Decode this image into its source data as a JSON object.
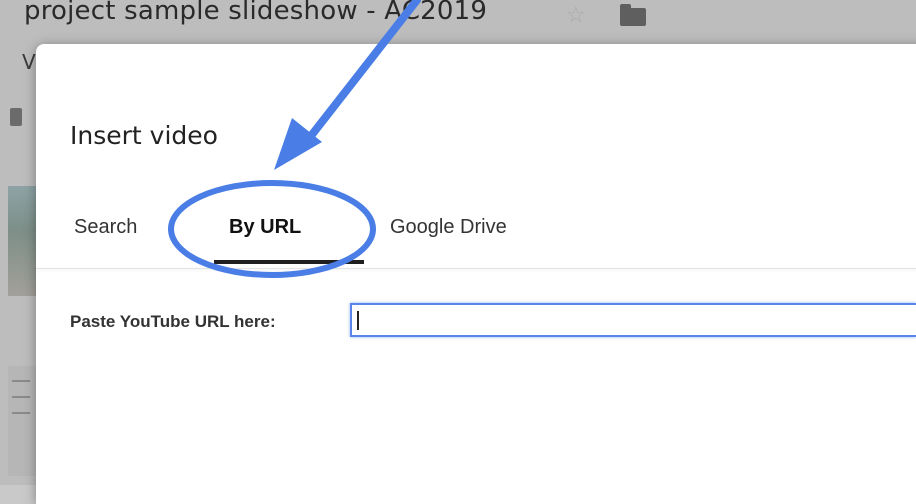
{
  "background": {
    "document_title": "project sample slideshow - AC2019",
    "menu_letter": "V",
    "icons": [
      "star-icon",
      "folder-icon"
    ]
  },
  "dialog": {
    "title": "Insert video",
    "tabs": [
      {
        "label": "Search",
        "selected": false
      },
      {
        "label": "By URL",
        "selected": true
      },
      {
        "label": "Google Drive",
        "selected": false
      }
    ],
    "url_field": {
      "label": "Paste YouTube URL here:",
      "value": "",
      "placeholder": ""
    }
  },
  "annotation": {
    "type": "arrow-and-circle",
    "target": "By URL",
    "color": "#4a7ee6"
  },
  "colors": {
    "focus_border": "#5b84e8",
    "annotation_blue": "#4a7ee6",
    "overlay_gray": "#bdbdbd"
  }
}
